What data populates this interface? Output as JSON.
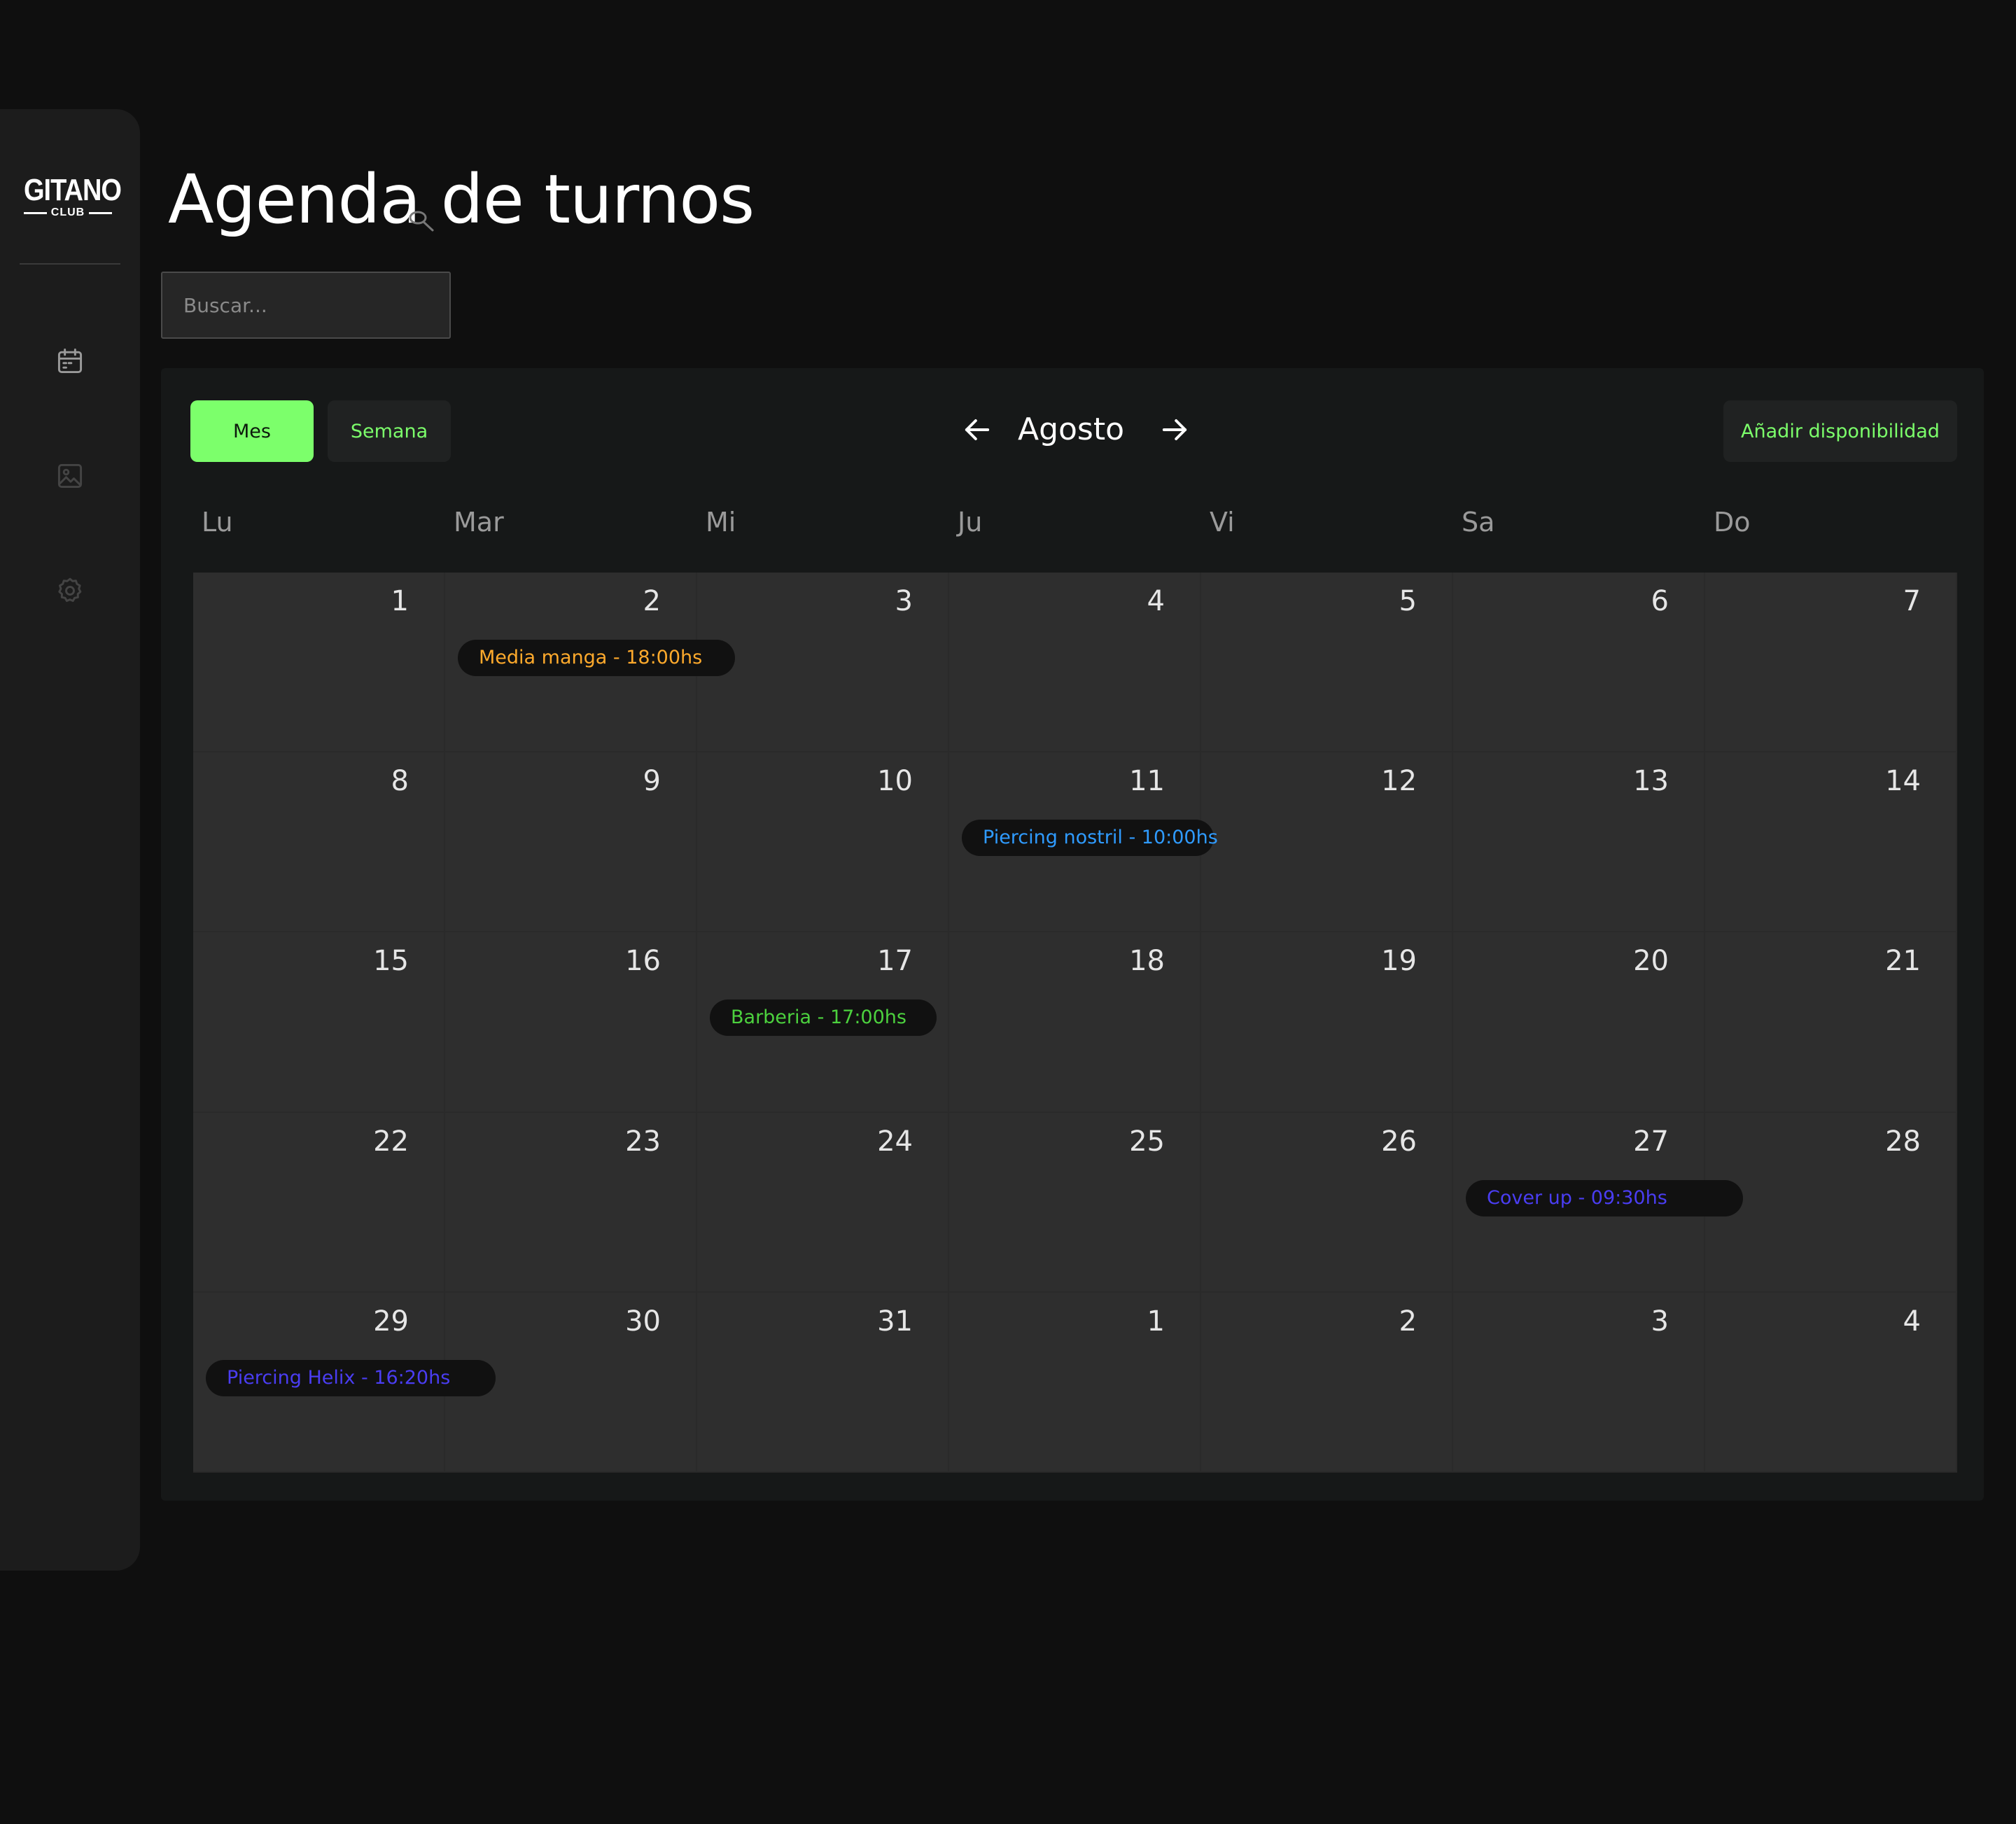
{
  "sidebar": {
    "logo_main": "GITANO",
    "logo_sub": "CLUB",
    "icons": [
      "calendar-icon",
      "image-icon",
      "settings-icon"
    ]
  },
  "header": {
    "title": "Agenda de turnos"
  },
  "search": {
    "placeholder": "Buscar..."
  },
  "calendar": {
    "view_buttons": {
      "month": "Mes",
      "week": "Semana"
    },
    "month_label": "Agosto",
    "add_button": "Añadir disponibilidad",
    "weekdays": [
      "Lu",
      "Mar",
      "Mi",
      "Ju",
      "Vi",
      "Sa",
      "Do"
    ],
    "days": [
      "1",
      "2",
      "3",
      "4",
      "5",
      "6",
      "7",
      "8",
      "9",
      "10",
      "11",
      "12",
      "13",
      "14",
      "15",
      "16",
      "17",
      "18",
      "19",
      "20",
      "21",
      "22",
      "23",
      "24",
      "25",
      "26",
      "27",
      "28",
      "29",
      "30",
      "31",
      "1",
      "2",
      "3",
      "4"
    ],
    "events": [
      {
        "cell": 1,
        "label": "Media manga -  18:00hs",
        "color": "#ffaa2c",
        "span": 1.2
      },
      {
        "cell": 10,
        "label": "Piercing nostril - 10:00hs",
        "color": "#2f9bff",
        "span": 1.1
      },
      {
        "cell": 16,
        "label": "Barberia - 17:00hs",
        "color": "#4cd13e",
        "span": 1.0
      },
      {
        "cell": 26,
        "label": "Cover up - 09:30hs",
        "color": "#4a3df2",
        "span": 1.2
      },
      {
        "cell": 28,
        "label": "Piercing Helix - 16:20hs",
        "color": "#4a3df2",
        "span": 1.25
      }
    ]
  },
  "colors": {
    "accent": "#7cff6b",
    "background": "#0f0f0f",
    "cell": "#2e2e2e"
  }
}
